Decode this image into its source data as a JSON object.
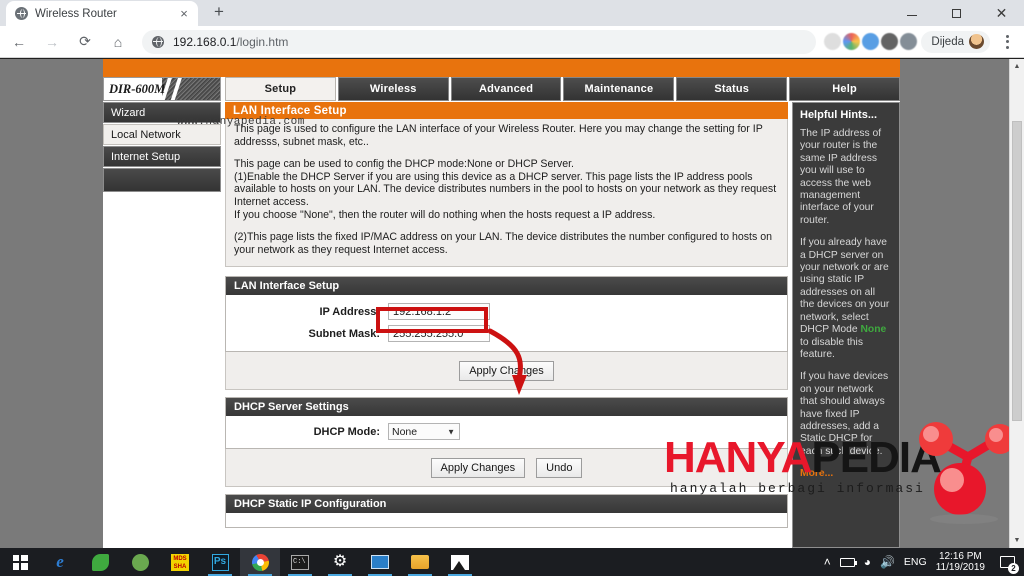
{
  "browser": {
    "tab_title": "Wireless Router",
    "tab_favicon": "globe-icon",
    "new_tab_label": "+",
    "close_tab_label": "×",
    "back_label": "←",
    "forward_label": "→",
    "reload_label": "⟳",
    "home_label": "⌂",
    "url_host": "192.168.0.1",
    "url_path": "/login.htm",
    "profile_name": "Dijeda",
    "window_minimize": "–",
    "window_maximize": "❐",
    "window_close": "✕"
  },
  "router": {
    "brand": "DIR-600M",
    "nav_tabs": [
      {
        "label": "Setup",
        "active": true
      },
      {
        "label": "Wireless",
        "active": false
      },
      {
        "label": "Advanced",
        "active": false
      },
      {
        "label": "Maintenance",
        "active": false
      },
      {
        "label": "Status",
        "active": false
      },
      {
        "label": "Help",
        "active": false
      }
    ],
    "sidebar": [
      {
        "label": "Wizard",
        "active": false
      },
      {
        "label": "Local Network",
        "active": true
      },
      {
        "label": "Internet Setup",
        "active": false
      }
    ],
    "panel_title": "LAN Interface Setup",
    "description": [
      "This page is used to configure the LAN interface of your Wireless Router. Here you may change the setting for IP addresss, subnet mask, etc..",
      "This page can be used to config the DHCP mode:None or DHCP Server.\n(1)Enable the DHCP Server if you are using this device as a DHCP server. This page lists the IP address pools available to hosts on your LAN. The device distributes numbers in the pool to hosts on your network as they request Internet access.\nIf you choose \"None\", then the router will do nothing when the hosts request a IP address.",
      "(2)This page lists the fixed IP/MAC address on your LAN. The device distributes the number configured to hosts on your network as they request Internet access."
    ],
    "lan_section": {
      "title": "LAN Interface Setup",
      "ip_label": "IP Address:",
      "ip_value": "192.168.1.2",
      "mask_label": "Subnet Mask:",
      "mask_value": "255.255.255.0",
      "apply_label": "Apply Changes"
    },
    "dhcp_section": {
      "title": "DHCP Server Settings",
      "mode_label": "DHCP Mode:",
      "mode_value": "None",
      "mode_caret": "▼",
      "apply_label": "Apply Changes",
      "undo_label": "Undo"
    },
    "static_section": {
      "title": "DHCP Static IP Configuration"
    },
    "hints": {
      "heading": "Helpful Hints...",
      "p1": "The IP address of your router is the same IP address you will use to access the web management interface of your router.",
      "p2_before": "If you already have a DHCP server on your network or are using static IP addresses on all the devices on your network, select DHCP Mode ",
      "p2_highlight": "None",
      "p2_after": " to disable this feature.",
      "p3": "If you have devices on your network that should always have fixed IP addresses, add a Static DHCP for each such device.",
      "more": "More..."
    },
    "colors": {
      "accent_orange": "#e8730d",
      "header_dark": "#3b3b3b",
      "hint_green": "#3fa93f",
      "annotation_red": "#cc1111"
    }
  },
  "watermark": {
    "part1": "HANYA",
    "part2": "PEDIA",
    "tagline": "hanyalah berbagi informasi",
    "url": "www.hanyapedia.com"
  },
  "scrollbar": {
    "up_arrow": "▲",
    "down_arrow": "▼"
  },
  "taskbar": {
    "start_label": "start-button",
    "items": [
      {
        "name": "edge",
        "glyph": "e"
      },
      {
        "name": "leaf-app",
        "glyph": ""
      },
      {
        "name": "android-studio",
        "glyph": ""
      },
      {
        "name": "mds-sha",
        "glyph": "MDS\nSHA"
      },
      {
        "name": "photoshop",
        "glyph": "Ps"
      },
      {
        "name": "chrome",
        "glyph": ""
      },
      {
        "name": "terminal",
        "glyph": ""
      },
      {
        "name": "settings",
        "glyph": "⚙"
      },
      {
        "name": "card-app",
        "glyph": ""
      },
      {
        "name": "file-explorer",
        "glyph": ""
      },
      {
        "name": "photos",
        "glyph": ""
      }
    ],
    "tray": {
      "chevron": "˄",
      "battery": "battery-icon",
      "wifi": "wifi-icon",
      "volume": "volume-icon",
      "language": "ENG",
      "time": "12:16 PM",
      "date": "11/19/2019",
      "notification_count": "2"
    }
  }
}
